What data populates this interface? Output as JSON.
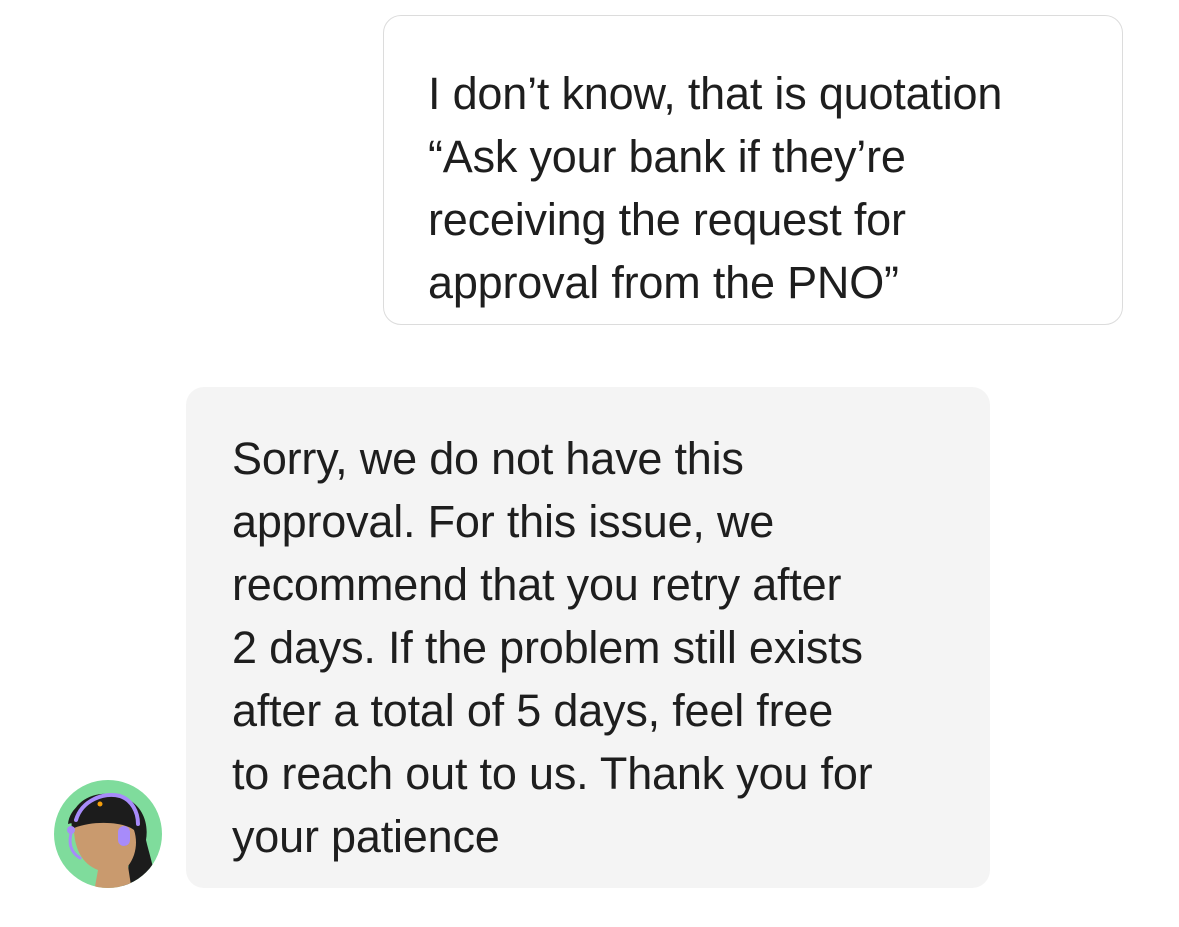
{
  "conversation": {
    "messages": [
      {
        "sender": "user",
        "text": "I don’t know, that is quotation\n“Ask your bank if they’re\nreceiving the request for\napproval from the PNO”"
      },
      {
        "sender": "agent",
        "text": "Sorry, we do not have this\napproval. For this issue, we\nrecommend that you retry after\n2 days. If the problem still exists\nafter a total of 5 days, feel free\nto reach out to us. Thank you for\nyour patience"
      }
    ],
    "agent_avatar": {
      "icon": "support-agent-avatar-icon",
      "background_color": "#7fdc9c",
      "headset_color": "#a78bfa"
    }
  },
  "colors": {
    "user_bubble_bg": "#ffffff",
    "user_bubble_border": "#dcdcdc",
    "agent_bubble_bg": "#f4f4f4",
    "text": "#1e1e1e"
  }
}
